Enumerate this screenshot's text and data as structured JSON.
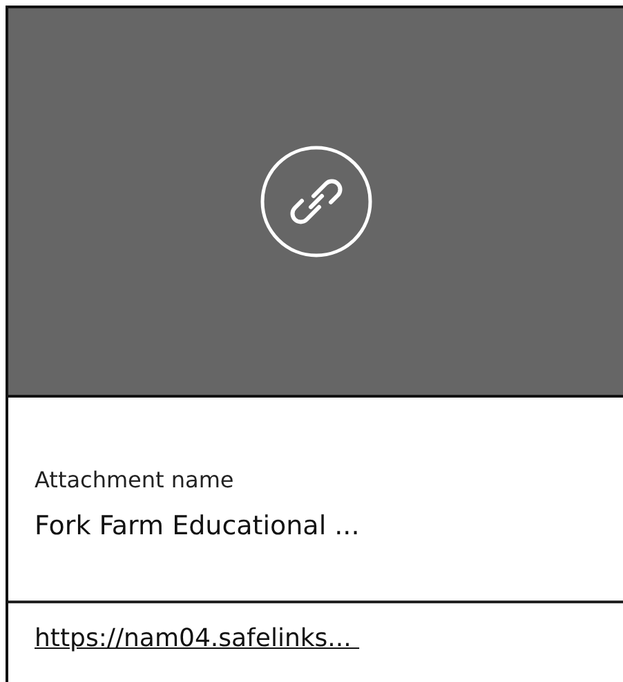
{
  "preview": {
    "kind": "link"
  },
  "attachment": {
    "label": "Attachment name",
    "name": "Fork Farm Educational ..."
  },
  "link": "https://nam04.safelinks... "
}
